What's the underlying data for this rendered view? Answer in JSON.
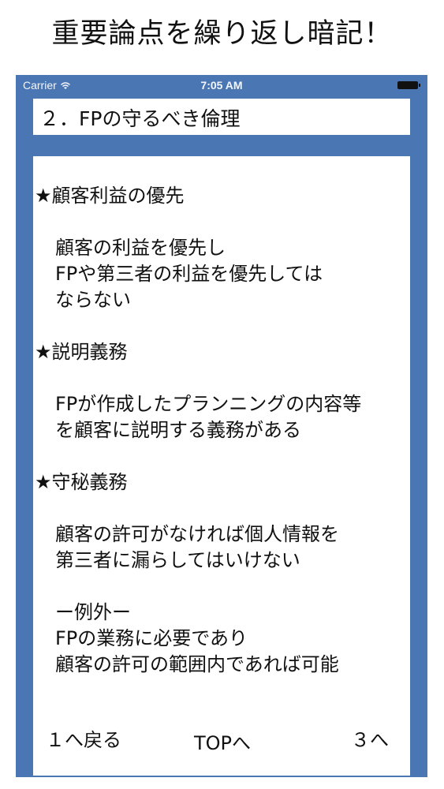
{
  "headline": "重要論点を繰り返し暗記！",
  "status_bar": {
    "carrier": "Carrier",
    "time": "7:05 AM",
    "wifi_icon": "wifi-icon",
    "battery_icon": "battery-icon"
  },
  "title": "２．FPの守るべき倫理",
  "content": {
    "sections": [
      {
        "heading": "★顧客利益の優先",
        "lines": [
          "顧客の利益を優先し",
          "FPや第三者の利益を優先しては",
          "ならない"
        ]
      },
      {
        "heading": "★説明義務",
        "lines": [
          "FPが作成したプランニングの内容等",
          "を顧客に説明する義務がある"
        ]
      },
      {
        "heading": "★守秘義務",
        "lines": [
          "顧客の許可がなければ個人情報を",
          "第三者に漏らしてはいけない"
        ],
        "extra_lines": [
          "ー例外ー",
          "FPの業務に必要であり",
          "顧客の許可の範囲内であれば可能"
        ]
      }
    ]
  },
  "buttons": {
    "back": "１へ戻る",
    "top": "TOPへ",
    "next": "３へ"
  },
  "colors": {
    "phone_background": "#4a76b3",
    "panel_background": "#ffffff"
  }
}
